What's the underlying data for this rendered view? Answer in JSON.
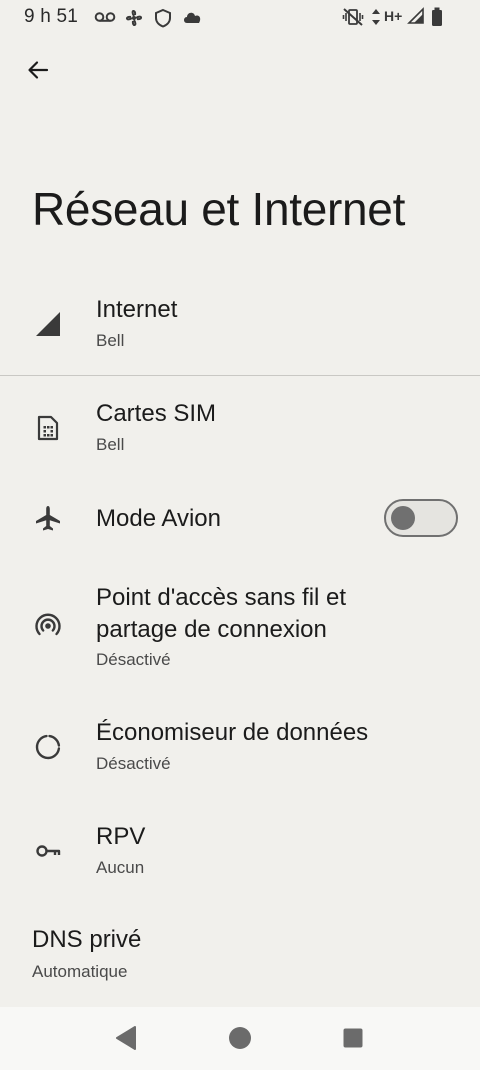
{
  "status_bar": {
    "time": "9 h 51",
    "network_label": "H+"
  },
  "header": {
    "title": "Réseau et Internet"
  },
  "settings": {
    "internet": {
      "title": "Internet",
      "subtitle": "Bell"
    },
    "sim": {
      "title": "Cartes SIM",
      "subtitle": "Bell"
    },
    "airplane": {
      "title": "Mode Avion",
      "enabled": false
    },
    "hotspot": {
      "title_line1": "Point d'accès sans fil et",
      "title_line2": "partage de connexion",
      "subtitle": "Désactivé"
    },
    "data_saver": {
      "title": "Économiseur de données",
      "subtitle": "Désactivé"
    },
    "vpn": {
      "title": "RPV",
      "subtitle": "Aucun"
    },
    "private_dns": {
      "title": "DNS privé",
      "subtitle": "Automatique"
    }
  },
  "colors": {
    "background": "#f1f0ec",
    "icon": "#3a3a3a",
    "toggle_off": "#707070"
  }
}
